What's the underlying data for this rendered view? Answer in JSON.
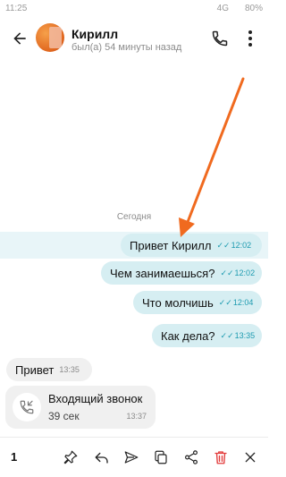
{
  "status_bar": {
    "time": "11:25",
    "network": "4G",
    "battery": "80%"
  },
  "header": {
    "contact_name": "Кирилл",
    "last_seen": "был(а) 54 минуты назад"
  },
  "date_separator": "Сегодня",
  "messages": [
    {
      "direction": "out",
      "text": "Привет Кирилл",
      "time": "12:02",
      "highlighted": true
    },
    {
      "direction": "out",
      "text": "Чем занимаешься?",
      "time": "12:02"
    },
    {
      "direction": "out",
      "text": "Что молчишь",
      "time": "12:04"
    },
    {
      "direction": "out",
      "text": "Как дела?",
      "time": "13:35"
    },
    {
      "direction": "in",
      "text": "Привет",
      "time": "13:35"
    }
  ],
  "call": {
    "title": "Входящий звонок",
    "duration": "39 сек",
    "time": "13:37"
  },
  "toolbar": {
    "selected_count": "1"
  },
  "colors": {
    "outgoing_bubble": "#d6eef2",
    "incoming_bubble": "#f0f0f0",
    "time_accent": "#1e9bb0",
    "arrow": "#f06a1f",
    "delete": "#e23b3b"
  },
  "icons": [
    "back-arrow-icon",
    "phone-icon",
    "more-vertical-icon",
    "incoming-call-icon",
    "pin-icon",
    "reply-icon",
    "send-forward-icon",
    "copy-icon",
    "share-icon",
    "trash-icon",
    "close-icon"
  ]
}
